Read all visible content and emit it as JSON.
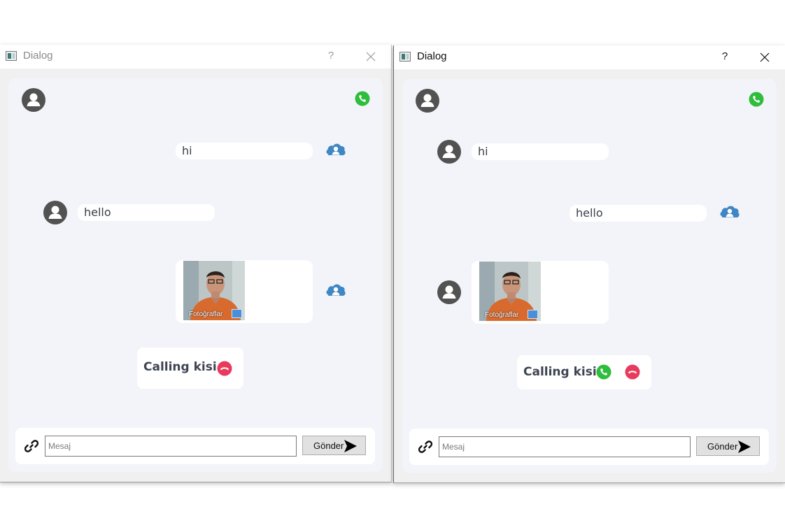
{
  "dialogs": [
    {
      "title": "Dialog",
      "help": "?",
      "messages": {
        "m1": "hi",
        "m2": "hello",
        "photo_caption": "Fotoğraflar"
      },
      "calling": {
        "text": "Calling kisi"
      },
      "input": {
        "placeholder": "Mesaj",
        "send_label": "Gönder"
      }
    },
    {
      "title": "Dialog",
      "help": "?",
      "messages": {
        "m1": "hi",
        "m2": "hello",
        "photo_caption": "Fotoğraflar"
      },
      "calling": {
        "text": "Calling kisi"
      },
      "input": {
        "placeholder": "Mesaj",
        "send_label": "Gönder"
      }
    }
  ],
  "icons": [
    "app-icon",
    "help-icon",
    "close-icon",
    "user-avatar-icon",
    "phone-accept-icon",
    "phone-hangup-icon",
    "sent-user-icon",
    "link-icon",
    "send-arrow-icon"
  ],
  "colors": {
    "accept": "#2ebd3c",
    "hangup": "#e83a5c",
    "avatar": "#505050",
    "self_avatar": "#3f86c4",
    "panel": "#f2f4f9"
  }
}
